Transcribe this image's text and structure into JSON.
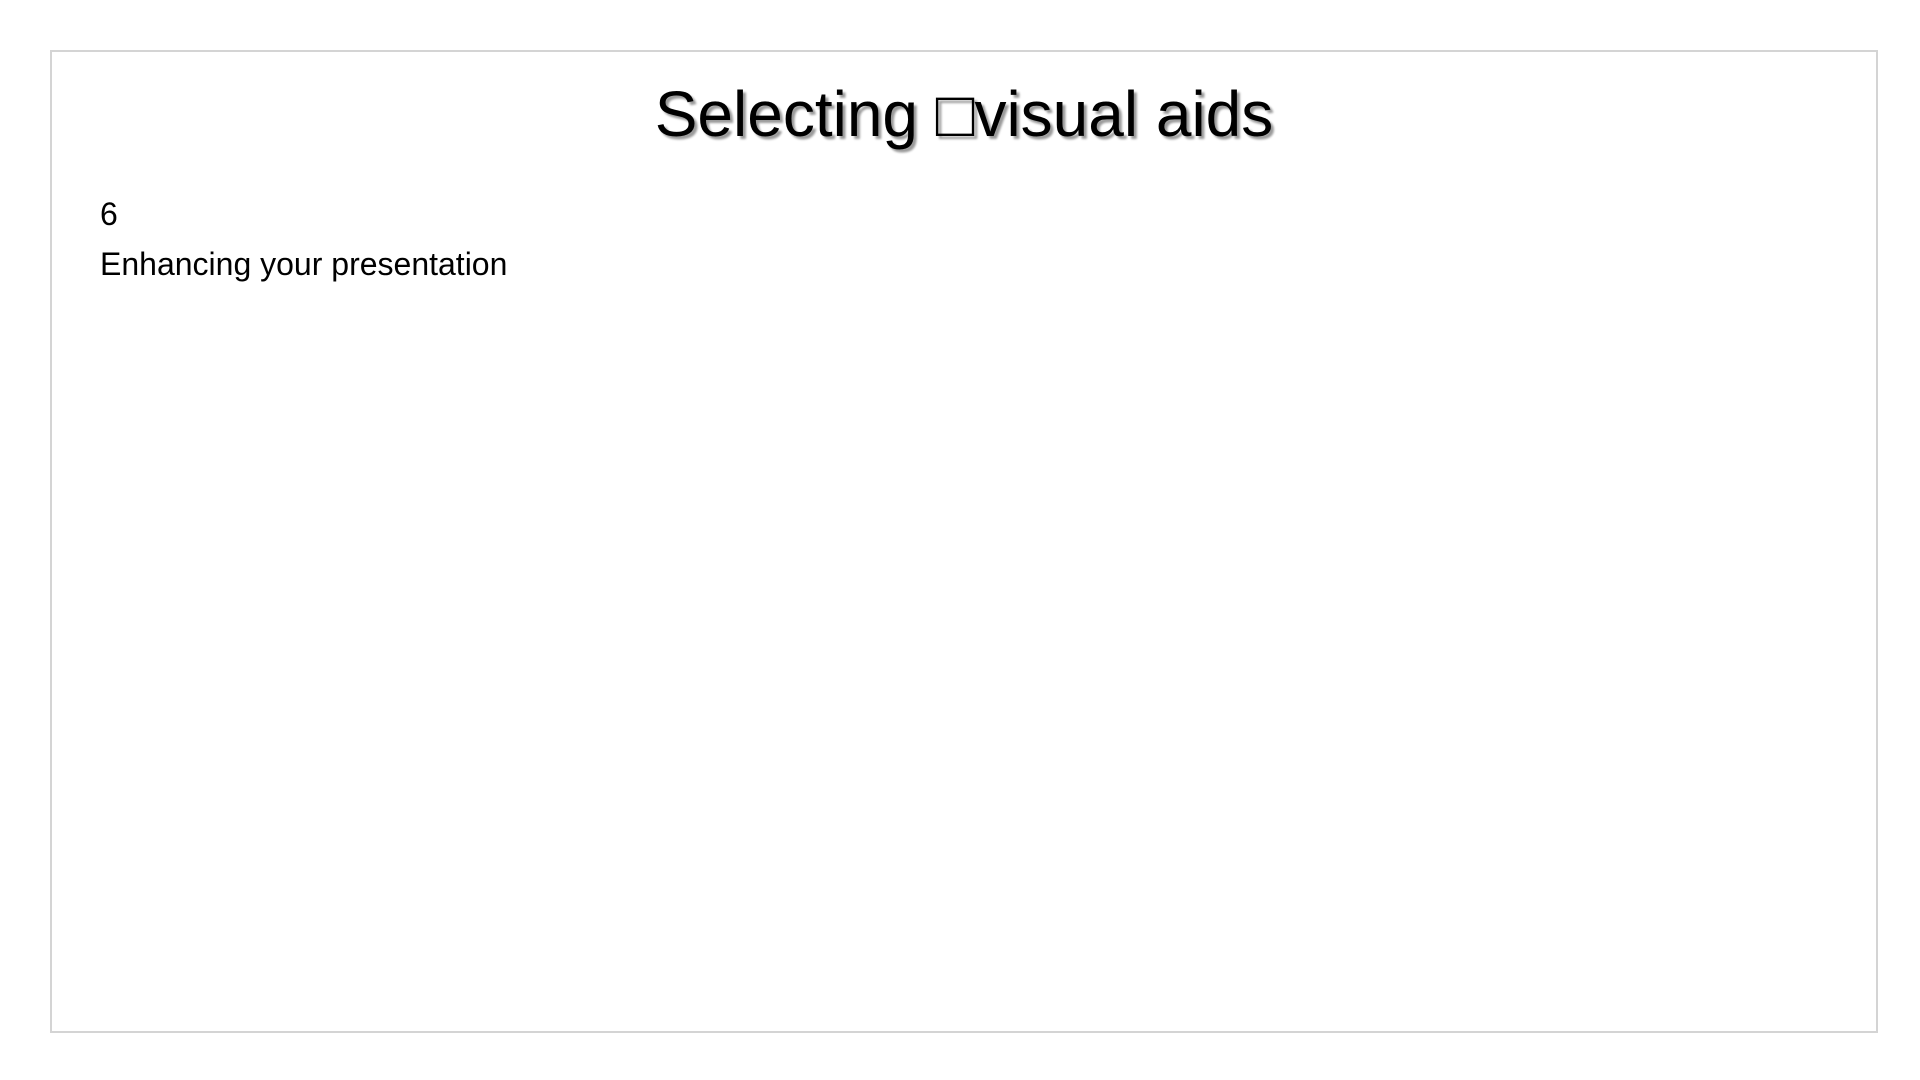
{
  "slide": {
    "title": "Selecting □visual aids",
    "body": {
      "slide_number": "6",
      "text": "Enhancing your presentation"
    }
  }
}
